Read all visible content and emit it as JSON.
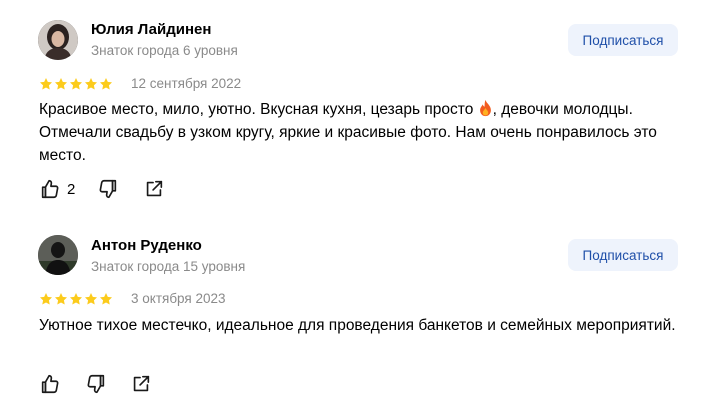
{
  "reviews": [
    {
      "author": "Юлия Лайдинен",
      "level": "Знаток города 6 уровня",
      "subscribe_label": "Подписаться",
      "rating": 5,
      "date": "12 сентября 2022",
      "text_before": "Красивое место, мило, уютно. Вкусная кухня, цезарь просто",
      "text_emoji": "fire-emoji",
      "text_after": ", девочки молодцы. Отмечали свадьбу в узком кругу, яркие и красивые фото. Нам очень понравилось это место.",
      "likes": "2"
    },
    {
      "author": "Антон Руденко",
      "level": "Знаток города 15 уровня",
      "subscribe_label": "Подписаться",
      "rating": 5,
      "date": "3 октября 2023",
      "text": "Уютное тихое местечко, идеальное для проведения банкетов и семейных мероприятий."
    }
  ],
  "colors": {
    "star": "#fccb1c",
    "subscribe_bg": "#eef3fc",
    "subscribe_text": "#1f4fa8",
    "muted": "#8a8a8a"
  },
  "icons": [
    "thumbs-up-icon",
    "thumbs-down-icon",
    "share-icon"
  ]
}
